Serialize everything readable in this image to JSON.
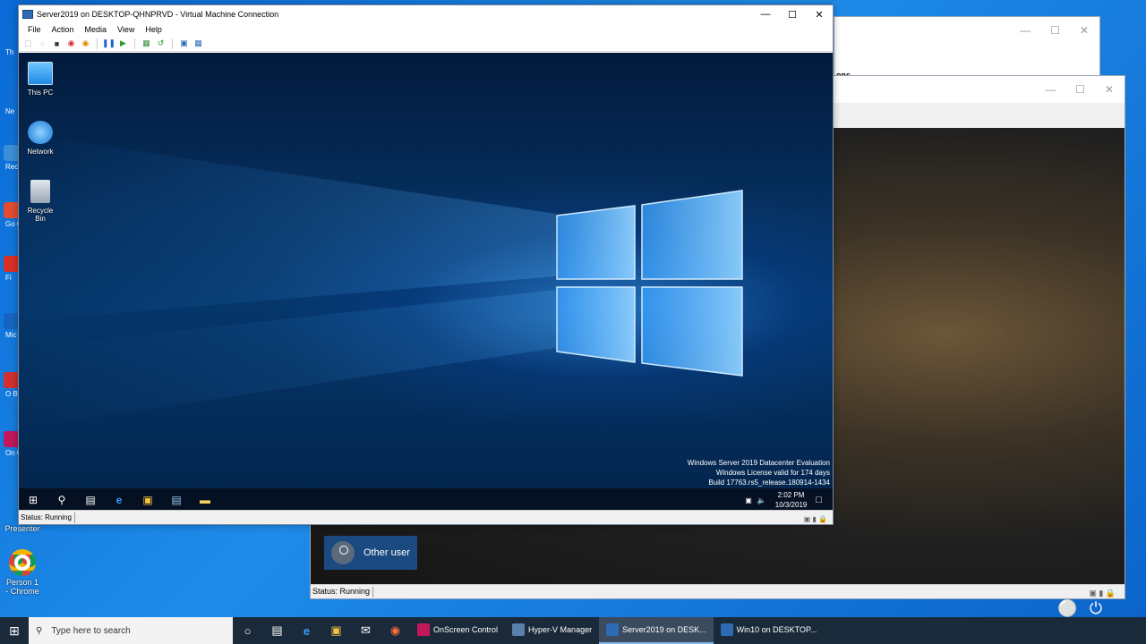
{
  "host": {
    "taskbar": {
      "search_placeholder": "Type here to search",
      "apps": [
        {
          "label": "OnScreen Control",
          "color": "#c2185b",
          "active": false
        },
        {
          "label": "Hyper-V Manager",
          "color": "#5a7fa8",
          "active": false
        },
        {
          "label": "Server2019 on DESK...",
          "color": "#2d6cb5",
          "active": true
        },
        {
          "label": "Win10 on DESKTOP...",
          "color": "#2d6cb5",
          "active": false
        }
      ]
    },
    "desktop_icons": {
      "presenter_label": "Presenter",
      "chrome_label": "Person 1 - Chrome"
    },
    "left_fragments": [
      "Th",
      "Ne",
      "Recy",
      "Go Ch",
      "Fi",
      "Mic E",
      "O Bri",
      "On Co"
    ]
  },
  "bg_window1": {
    "fragment": "ons"
  },
  "win10_vm": {
    "other_user_label": "Other user",
    "status_label": "Status: Running"
  },
  "vm": {
    "window_title": "Server2019 on DESKTOP-QHNPRVD - Virtual Machine Connection",
    "menu": [
      "File",
      "Action",
      "Media",
      "View",
      "Help"
    ],
    "desktop_icons": [
      "This PC",
      "Network",
      "Recycle Bin"
    ],
    "watermark": {
      "line1": "Windows Server 2019 Datacenter Evaluation",
      "line2": "Windows License valid for 174 days",
      "line3": "Build 17763.rs5_release.180914-1434"
    },
    "clock": {
      "time": "2:02 PM",
      "date": "10/3/2019"
    },
    "status_label": "Status: Running"
  }
}
